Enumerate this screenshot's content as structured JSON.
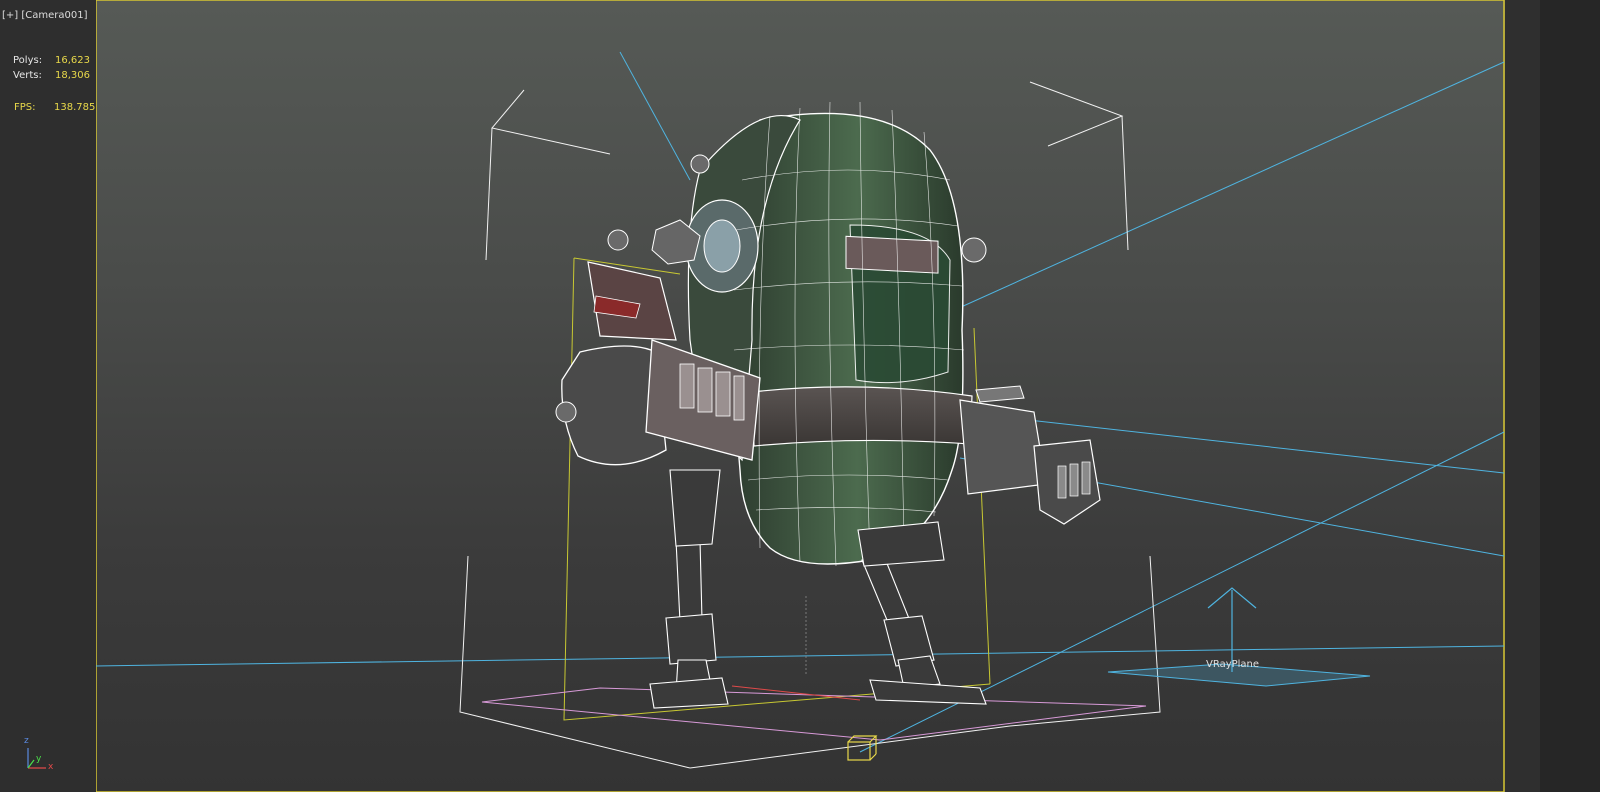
{
  "viewport": {
    "menu_label": "[+]",
    "camera_label": "[Camera001]"
  },
  "stats": {
    "polys_label": "Polys:",
    "polys_value": "16,623",
    "verts_label": "Verts:",
    "verts_value": "18,306",
    "fps_label": "FPS:",
    "fps_value": "138.785"
  },
  "scene": {
    "object_label": "VRayPlane",
    "axis_tripod": {
      "z": "z",
      "y": "y",
      "x": "x"
    }
  },
  "colors": {
    "frame_border": "#d6c632",
    "stats_value": "#e8d84a",
    "light_lines": "#4fb4e0",
    "wireframe": "#ffffff",
    "bbox_yellow": "#c8c832",
    "ground_plane": "#d89ad8",
    "axis_x": "#e04a4a",
    "axis_y": "#4ae04a",
    "axis_z": "#5a8ae0",
    "body_green": "#3d5a40"
  },
  "icons": [
    "vray-plane-icon",
    "camera-target-icon",
    "axis-tripod-icon",
    "light-direction-arrow-icon"
  ]
}
